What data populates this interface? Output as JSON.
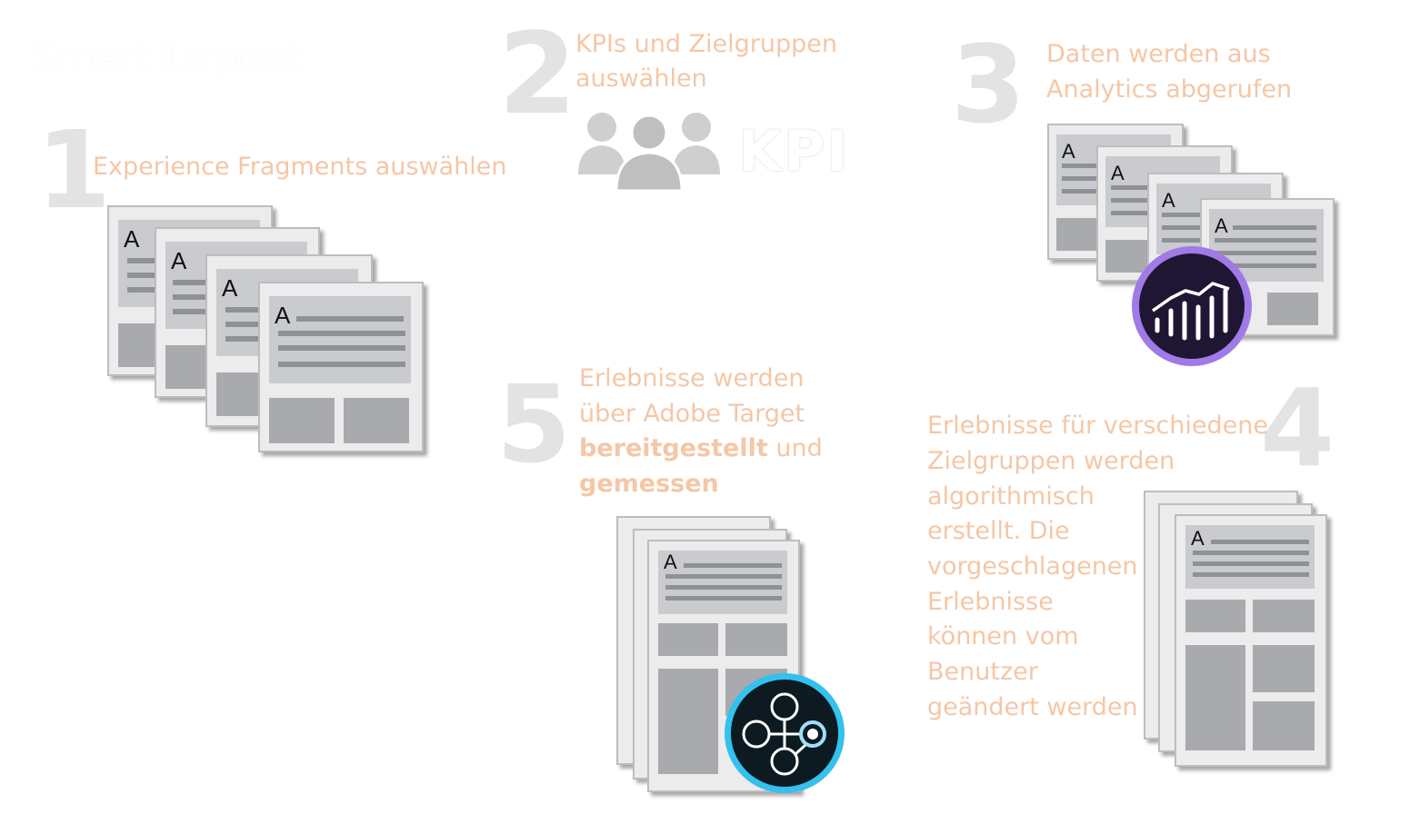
{
  "title": "Smart Layout",
  "steps": {
    "s1": {
      "number": "1",
      "text": "Experience Fragments auswählen"
    },
    "s2": {
      "number": "2",
      "line1": "KPIs und Zielgruppen",
      "line2": "auswählen",
      "kpi": "KPI"
    },
    "s3": {
      "number": "3",
      "line1": "Daten werden aus",
      "line2": "Analytics abgerufen"
    },
    "s4": {
      "number": "4",
      "lines": [
        "Erlebnisse für verschiedene",
        "Zielgruppen werden",
        "algorithmisch",
        "erstellt. Die",
        "vorgeschlagenen",
        "Erlebnisse",
        "können vom",
        "Benutzer",
        "geändert werden"
      ]
    },
    "s5": {
      "number": "5",
      "line1": "Erlebnisse werden",
      "line2": "über Adobe Target",
      "bold1": "bereitgestellt",
      "rest": " und",
      "bold2": "gemessen"
    }
  },
  "doc_letter": "A",
  "icons": {
    "people": "people-group-icon",
    "analytics": "adobe-analytics-icon",
    "target": "adobe-target-icon"
  },
  "colors": {
    "step_text": "#f4c7a6",
    "step_number": "#e3e3e3",
    "analytics_ring": "#9a6fe0",
    "target_ring": "#2db8e6"
  }
}
